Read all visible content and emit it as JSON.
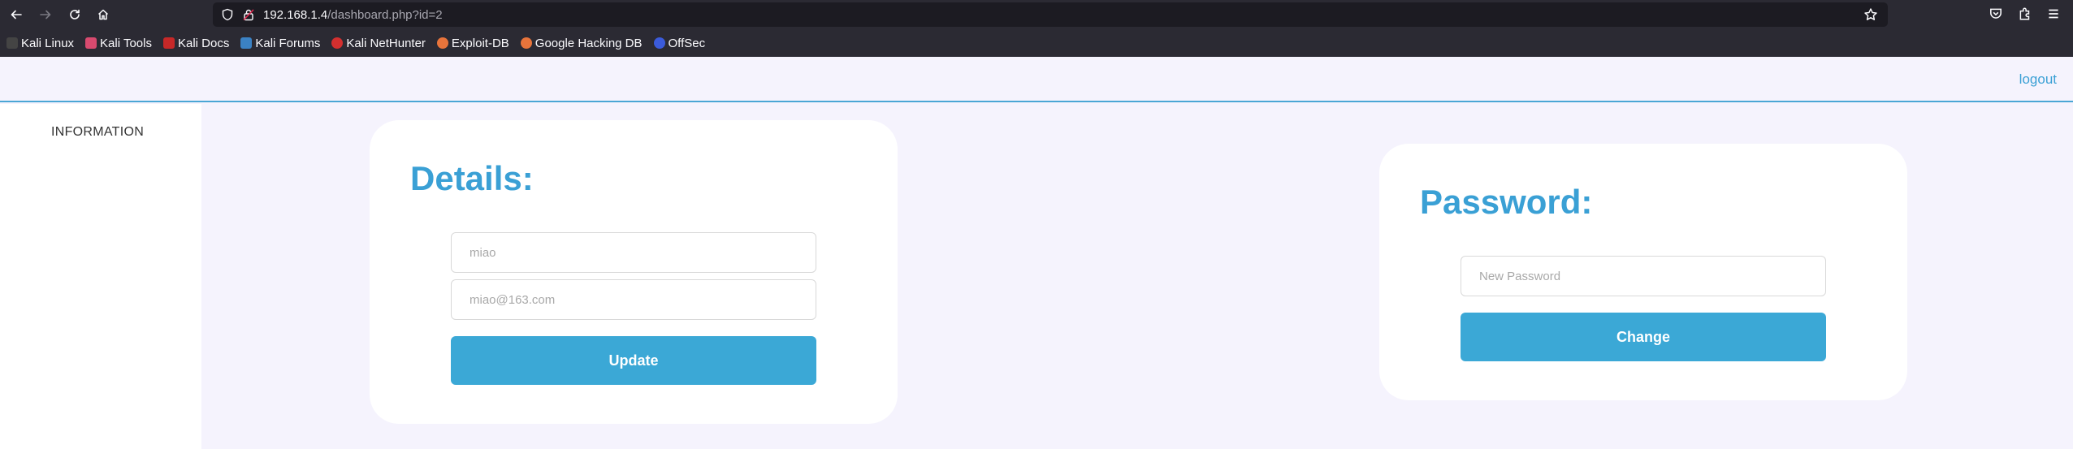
{
  "browser": {
    "url_host": "192.168.1.4",
    "url_path": "/dashboard.php?id=2",
    "bookmarks": [
      {
        "label": "Kali Linux",
        "color": "#3a3a3a"
      },
      {
        "label": "Kali Tools",
        "color": "#d84a6f"
      },
      {
        "label": "Kali Docs",
        "color": "#c62828"
      },
      {
        "label": "Kali Forums",
        "color": "#3b82c4"
      },
      {
        "label": "Kali NetHunter",
        "color": "#d32f2f"
      },
      {
        "label": "Exploit-DB",
        "color": "#e8743b"
      },
      {
        "label": "Google Hacking DB",
        "color": "#e8743b"
      },
      {
        "label": "OffSec",
        "color": "#3b5bdb"
      }
    ]
  },
  "header": {
    "logout_label": "logout"
  },
  "sidebar": {
    "information_label": "INFORMATION"
  },
  "details": {
    "title": "Details:",
    "name_placeholder": "miao",
    "email_placeholder": "miao@163.com",
    "update_label": "Update"
  },
  "password": {
    "title": "Password:",
    "new_password_placeholder": "New Password",
    "change_label": "Change"
  },
  "colors": {
    "accent": "#3aa0d5",
    "background": "#f5f3fd"
  }
}
